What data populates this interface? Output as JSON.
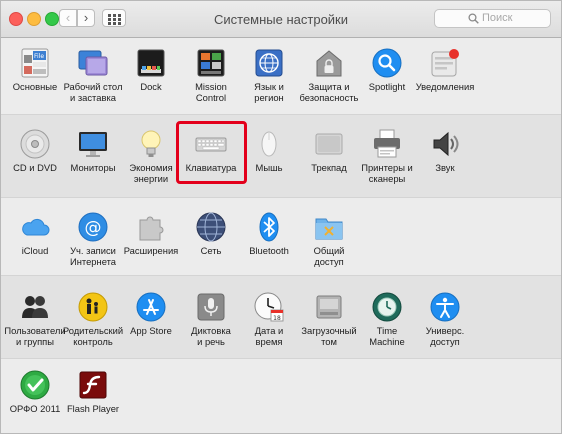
{
  "window": {
    "title": "Системные настройки"
  },
  "search": {
    "placeholder": "Поиск"
  },
  "rows": [
    [
      {
        "label": "Основные",
        "icon": "general-icon"
      },
      {
        "label": "Рабочий стол\nи заставка",
        "icon": "desktop-icon"
      },
      {
        "label": "Dock",
        "icon": "dock-icon"
      },
      {
        "label": "Mission\nControl",
        "icon": "mission-control-icon"
      },
      {
        "label": "Язык и\nрегион",
        "icon": "language-icon"
      },
      {
        "label": "Защита и\nбезопасность",
        "icon": "security-icon"
      },
      {
        "label": "Spotlight",
        "icon": "spotlight-icon"
      },
      {
        "label": "Уведомления",
        "icon": "notifications-icon"
      }
    ],
    [
      {
        "label": "CD и DVD",
        "icon": "cd-dvd-icon"
      },
      {
        "label": "Мониторы",
        "icon": "monitor-icon"
      },
      {
        "label": "Экономия\nэнергии",
        "icon": "energy-icon"
      },
      {
        "label": "Клавиатура",
        "icon": "keyboard-icon"
      },
      {
        "label": "Мышь",
        "icon": "mouse-icon"
      },
      {
        "label": "Трекпад",
        "icon": "trackpad-icon"
      },
      {
        "label": "Принтеры и\nсканеры",
        "icon": "printer-icon"
      },
      {
        "label": "Звук",
        "icon": "sound-icon"
      }
    ],
    [
      {
        "label": "iCloud",
        "icon": "icloud-icon"
      },
      {
        "label": "Уч. записи\nИнтернета",
        "icon": "internet-accounts-icon"
      },
      {
        "label": "Расширения",
        "icon": "extensions-icon"
      },
      {
        "label": "Сеть",
        "icon": "network-icon"
      },
      {
        "label": "Bluetooth",
        "icon": "bluetooth-icon"
      },
      {
        "label": "Общий\nдоступ",
        "icon": "sharing-icon"
      }
    ],
    [
      {
        "label": "Пользователи\nи группы",
        "icon": "users-icon"
      },
      {
        "label": "Родительский\nконтроль",
        "icon": "parental-control-icon"
      },
      {
        "label": "App Store",
        "icon": "app-store-icon"
      },
      {
        "label": "Диктовка\nи речь",
        "icon": "dictation-icon"
      },
      {
        "label": "Дата и\nвремя",
        "icon": "date-time-icon"
      },
      {
        "label": "Загрузочный\nтом",
        "icon": "startup-disk-icon"
      },
      {
        "label": "Time\nMachine",
        "icon": "time-machine-icon"
      },
      {
        "label": "Универс.\nдоступ",
        "icon": "accessibility-icon"
      }
    ],
    [
      {
        "label": "ОРФО 2011",
        "icon": "orfo-icon"
      },
      {
        "label": "Flash Player",
        "icon": "flash-player-icon"
      }
    ]
  ],
  "selected": "Клавиатура",
  "colors": {
    "highlight": "#e3001b",
    "accent_blue": "#1f8ef1"
  }
}
